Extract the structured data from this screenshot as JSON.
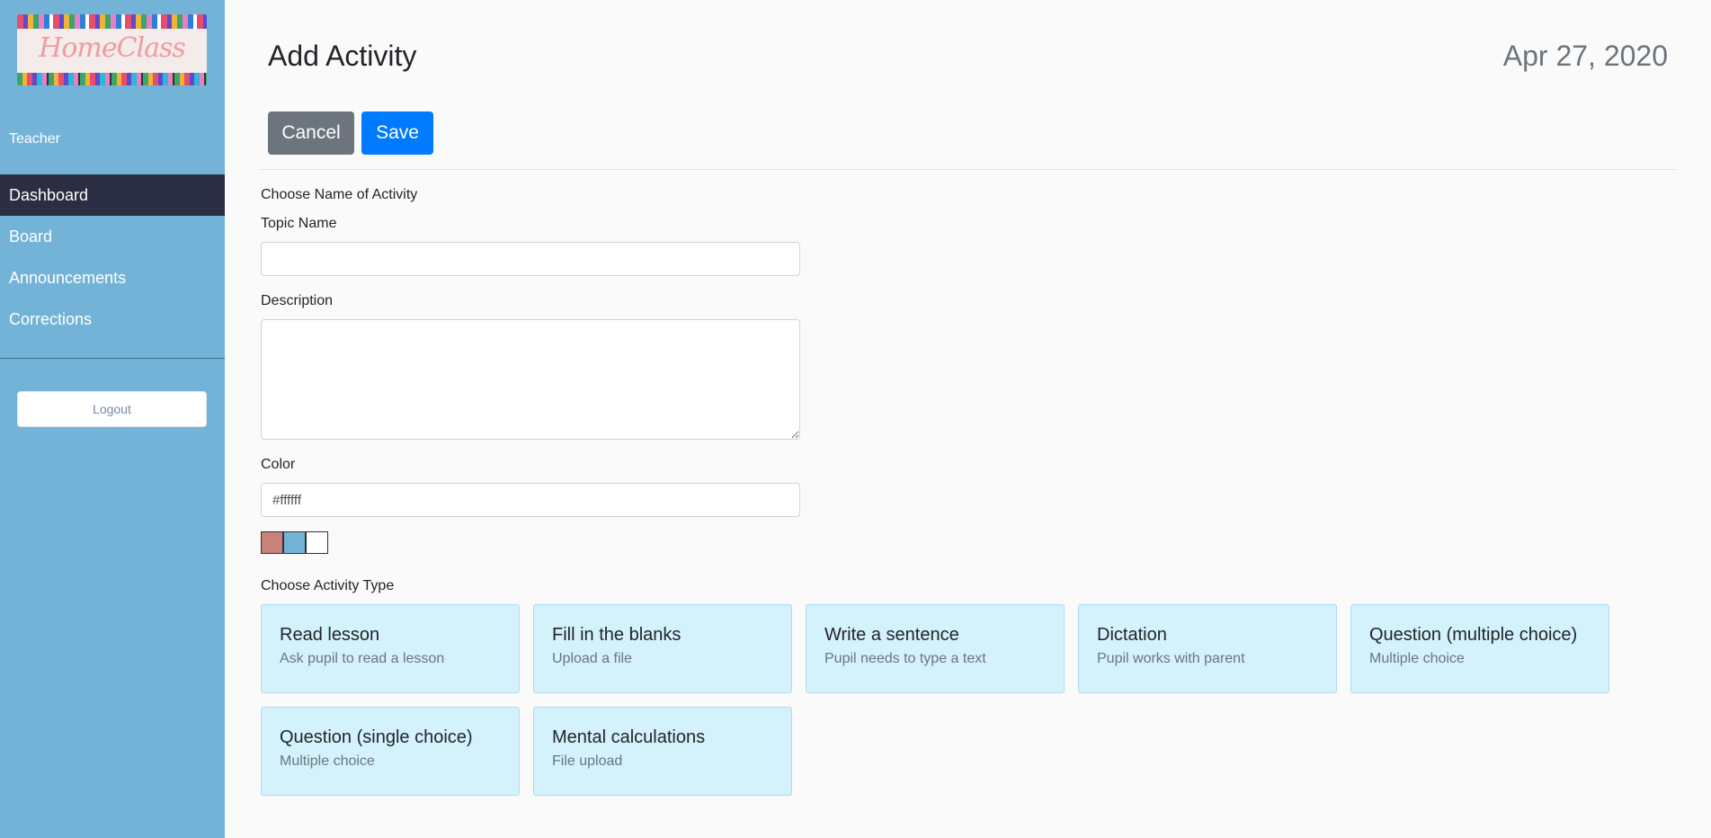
{
  "sidebar": {
    "logo_text": "HomeClass",
    "role": "Teacher",
    "nav": [
      "Dashboard",
      "Board",
      "Announcements",
      "Corrections"
    ],
    "active_nav": "Dashboard",
    "logout": "Logout"
  },
  "header": {
    "title": "Add Activity",
    "date": "Apr 27, 2020"
  },
  "toolbar": {
    "cancel_label": "Cancel",
    "save_label": "Save"
  },
  "form": {
    "section_name": "Choose Name of Activity",
    "topic_label": "Topic Name",
    "topic_value": "",
    "description_label": "Description",
    "description_value": "",
    "color_label": "Color",
    "color_value": "#ffffff",
    "swatches": [
      "#c98279",
      "#74b3d8",
      "#ffffff"
    ],
    "activity_section": "Choose Activity Type"
  },
  "activity_types": [
    {
      "title": "Read lesson",
      "subtitle": "Ask pupil to read a lesson"
    },
    {
      "title": "Fill in the blanks",
      "subtitle": "Upload a file"
    },
    {
      "title": "Write a sentence",
      "subtitle": "Pupil needs to type a text"
    },
    {
      "title": "Dictation",
      "subtitle": "Pupil works with parent"
    },
    {
      "title": "Question (multiple choice)",
      "subtitle": "Multiple choice"
    },
    {
      "title": "Question (single choice)",
      "subtitle": "Multiple choice"
    },
    {
      "title": "Mental calculations",
      "subtitle": "File upload"
    }
  ],
  "colors": {
    "sidebar": "#74b3d8",
    "nav_active": "#2b2d42",
    "cancel": "#6c757d",
    "save": "#007bff",
    "card": "#d3f2fc"
  }
}
